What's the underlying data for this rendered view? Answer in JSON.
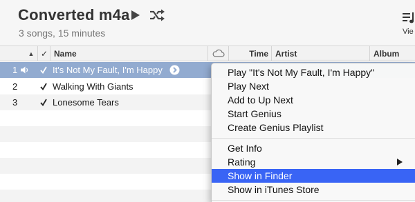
{
  "header": {
    "title": "Converted m4a",
    "subtitle": "3 songs, 15 minutes",
    "view_label": "Vie"
  },
  "columns": {
    "check": "✓",
    "name": "Name",
    "time": "Time",
    "artist": "Artist",
    "album": "Album"
  },
  "songs": [
    {
      "num": "1",
      "name": "It's Not My Fault, I'm Happy",
      "playing": true,
      "selected": true
    },
    {
      "num": "2",
      "name": "Walking With Giants",
      "playing": false,
      "selected": false
    },
    {
      "num": "3",
      "name": "Lonesome Tears",
      "playing": false,
      "selected": false
    }
  ],
  "context_menu": {
    "group1": [
      "Play \"It's Not My Fault, I'm Happy\"",
      "Play Next",
      "Add to Up Next",
      "Start Genius",
      "Create Genius Playlist"
    ],
    "group2": [
      "Get Info",
      "Rating",
      "Show in Finder",
      "Show in iTunes Store"
    ],
    "highlighted": "Show in Finder"
  },
  "colors": {
    "selection": "#92abd0",
    "menu_highlight": "#3964f5"
  }
}
